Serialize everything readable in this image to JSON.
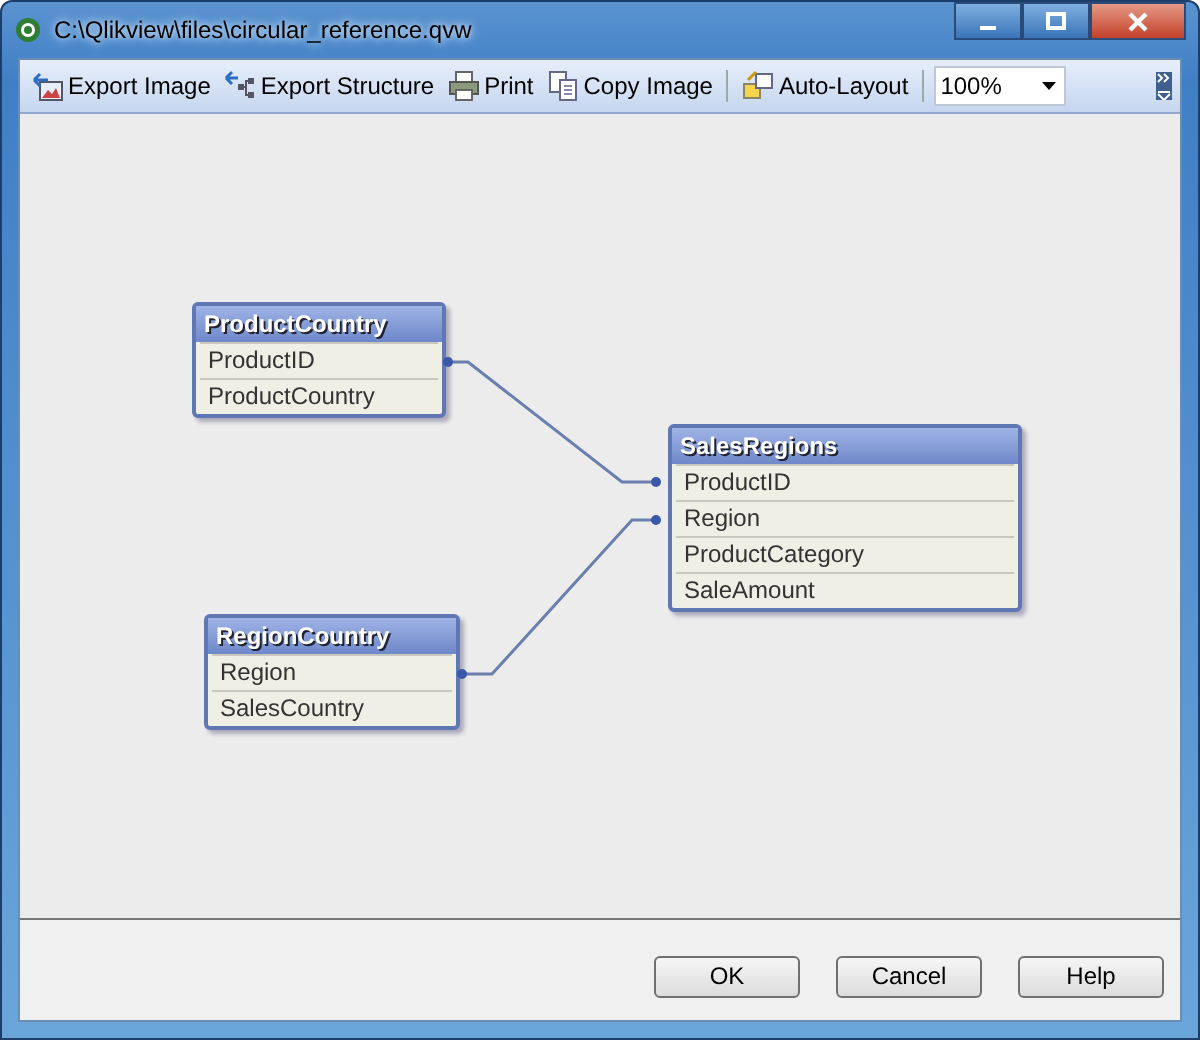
{
  "window": {
    "title": "C:\\Qlikview\\files\\circular_reference.qvw"
  },
  "toolbar": {
    "items": [
      {
        "kind": "export-image",
        "label": "Export Image"
      },
      {
        "kind": "export-structure",
        "label": "Export Structure"
      },
      {
        "kind": "print",
        "label": "Print"
      },
      {
        "kind": "copy-image",
        "label": "Copy Image"
      },
      {
        "kind": "separator"
      },
      {
        "kind": "auto-layout",
        "label": "Auto-Layout"
      },
      {
        "kind": "separator"
      }
    ],
    "zoom": {
      "value": "100%"
    }
  },
  "tables": [
    {
      "name": "ProductCountry",
      "fields": [
        "ProductID",
        "ProductCountry"
      ]
    },
    {
      "name": "RegionCountry",
      "fields": [
        "Region",
        "SalesCountry"
      ]
    },
    {
      "name": "SalesRegions",
      "fields": [
        "ProductID",
        "Region",
        "ProductCategory",
        "SaleAmount"
      ]
    }
  ],
  "buttons": [
    "OK",
    "Cancel",
    "Help"
  ]
}
